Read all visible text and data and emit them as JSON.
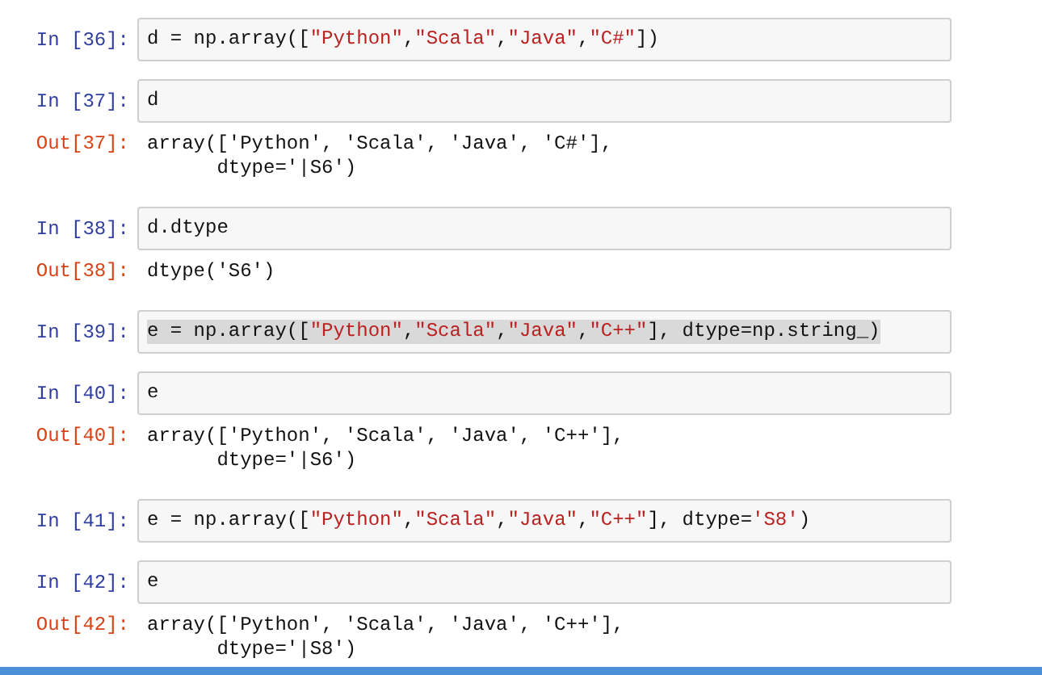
{
  "cells": [
    {
      "prompt": "In [36]:",
      "highlighted": false,
      "tokens": [
        {
          "text": "d = np.array([",
          "kind": "plain"
        },
        {
          "text": "\"Python\"",
          "kind": "string"
        },
        {
          "text": ",",
          "kind": "plain"
        },
        {
          "text": "\"Scala\"",
          "kind": "string"
        },
        {
          "text": ",",
          "kind": "plain"
        },
        {
          "text": "\"Java\"",
          "kind": "string"
        },
        {
          "text": ",",
          "kind": "plain"
        },
        {
          "text": "\"C#\"",
          "kind": "string"
        },
        {
          "text": "])",
          "kind": "plain"
        }
      ]
    },
    {
      "prompt": "In [37]:",
      "highlighted": false,
      "tokens": [
        {
          "text": "d",
          "kind": "plain"
        }
      ],
      "output": {
        "prompt": "Out[37]:",
        "lines": [
          "array(['Python', 'Scala', 'Java', 'C#'],",
          "      dtype='|S6')"
        ]
      }
    },
    {
      "prompt": "In [38]:",
      "highlighted": false,
      "tokens": [
        {
          "text": "d.dtype",
          "kind": "plain"
        }
      ],
      "output": {
        "prompt": "Out[38]:",
        "lines": [
          "dtype('S6')"
        ]
      }
    },
    {
      "prompt": "In [39]:",
      "highlighted": true,
      "tokens": [
        {
          "text": "e = np.array([",
          "kind": "plain"
        },
        {
          "text": "\"Python\"",
          "kind": "string"
        },
        {
          "text": ",",
          "kind": "plain"
        },
        {
          "text": "\"Scala\"",
          "kind": "string"
        },
        {
          "text": ",",
          "kind": "plain"
        },
        {
          "text": "\"Java\"",
          "kind": "string"
        },
        {
          "text": ",",
          "kind": "plain"
        },
        {
          "text": "\"C++\"",
          "kind": "string"
        },
        {
          "text": "], dtype=np.string_)",
          "kind": "plain"
        }
      ]
    },
    {
      "prompt": "In [40]:",
      "highlighted": false,
      "tokens": [
        {
          "text": "e",
          "kind": "plain"
        }
      ],
      "output": {
        "prompt": "Out[40]:",
        "lines": [
          "array(['Python', 'Scala', 'Java', 'C++'],",
          "      dtype='|S6')"
        ]
      }
    },
    {
      "prompt": "In [41]:",
      "highlighted": false,
      "tokens": [
        {
          "text": "e = np.array([",
          "kind": "plain"
        },
        {
          "text": "\"Python\"",
          "kind": "string"
        },
        {
          "text": ",",
          "kind": "plain"
        },
        {
          "text": "\"Scala\"",
          "kind": "string"
        },
        {
          "text": ",",
          "kind": "plain"
        },
        {
          "text": "\"Java\"",
          "kind": "string"
        },
        {
          "text": ",",
          "kind": "plain"
        },
        {
          "text": "\"C++\"",
          "kind": "string"
        },
        {
          "text": "], dtype=",
          "kind": "plain"
        },
        {
          "text": "'S8'",
          "kind": "string"
        },
        {
          "text": ")",
          "kind": "plain"
        }
      ]
    },
    {
      "prompt": "In [42]:",
      "highlighted": false,
      "tokens": [
        {
          "text": "e",
          "kind": "plain"
        }
      ],
      "output": {
        "prompt": "Out[42]:",
        "lines": [
          "array(['Python', 'Scala', 'Java', 'C++'],",
          "      dtype='|S8')"
        ]
      }
    }
  ]
}
